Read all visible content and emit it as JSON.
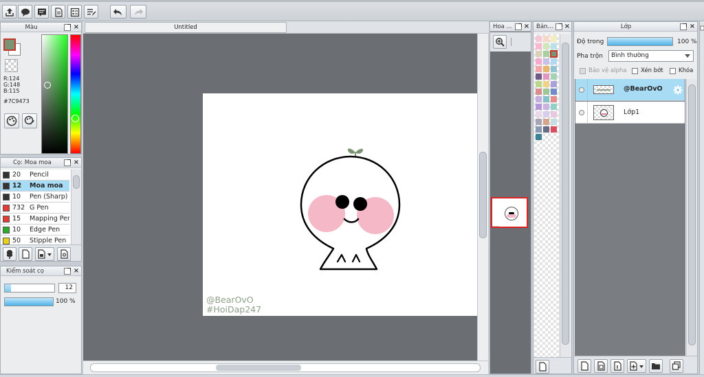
{
  "toolbar": {
    "buttons": [
      "export-icon",
      "comment-icon",
      "message-icon",
      "page-icon",
      "page-settings-icon",
      "list-edit-icon"
    ],
    "undo": "undo-icon",
    "redo": "redo-icon"
  },
  "color_panel": {
    "title": "Màu",
    "r": "R:124",
    "g": "G:148",
    "b": "B:115",
    "hex": "#7C9473",
    "main_color": "#7c9473",
    "sub_color": "#ffffff"
  },
  "canvas_tab": {
    "title": "Untitled"
  },
  "brush_panel": {
    "title": "Cọ: Moa moa",
    "brushes": [
      {
        "size": "20",
        "name": "Pencil",
        "color": "#333333"
      },
      {
        "size": "12",
        "name": "Moa moa",
        "color": "#333333",
        "selected": true
      },
      {
        "size": "10",
        "name": "Pen (Sharp)",
        "color": "#333333"
      },
      {
        "size": "732",
        "name": "G Pen",
        "color": "#e53935"
      },
      {
        "size": "15",
        "name": "Mapping Pen",
        "color": "#e53935"
      },
      {
        "size": "10",
        "name": "Edge Pen",
        "color": "#2eaa2e"
      },
      {
        "size": "50",
        "name": "Stipple Pen",
        "color": "#e8d21a"
      }
    ]
  },
  "brush_control": {
    "title": "Kiểm soát cọ",
    "size_value": "12",
    "size_fraction": 0.13,
    "opacity_label": "100 %",
    "opacity_fraction": 1.0
  },
  "navigator": {
    "title": "Hoa ..."
  },
  "swatch_panel": {
    "title": "Bản...",
    "colors": [
      "#f6c7d8",
      "#f7d7c8",
      "#f3eec2",
      "#f9b8cf",
      "#cfe8b9",
      "#b9e1ea",
      "#d9d2b8",
      "#a9cfa0",
      "#7c9473",
      "#f5aacd",
      "#c5c1e8",
      "#b5d8f2",
      "#f3a6a8",
      "#e7b56c",
      "#8fc4d7",
      "#6e5a86",
      "#e296c0",
      "#a3d3b5",
      "#b9d88d",
      "#f1d387",
      "#a7a2dc",
      "#d98d8c",
      "#9ec697",
      "#6f8bc8",
      "#c3b0de",
      "#86c0c9",
      "#e58d8d",
      "#b496d9",
      "#cab3de",
      "#8fd0c7",
      "#ecd8ec",
      "#d6cdea",
      "#e8c8e0",
      "#a7a4b6",
      "#d8a38d",
      "#c4dde2",
      "#8b9ab3",
      "#6a6c86",
      "#d94d5e",
      "#3c8194"
    ]
  },
  "layer_panel": {
    "title": "Lớp",
    "opacity_label": "Độ trong",
    "opacity_value": "100 %",
    "opacity_fraction": 1.0,
    "blend_label": "Pha trộn",
    "blend_value": "Bình thường",
    "protect_alpha": "Bảo vệ alpha",
    "clipping": "Xén bớt",
    "lock": "Khóa",
    "layers": [
      {
        "name": "@BearOvO",
        "selected": true
      },
      {
        "name": "Lớp1",
        "selected": false
      }
    ]
  },
  "artwork": {
    "watermark_line1": "@BearOvO",
    "watermark_line2": "#HoiDap247",
    "watermark_color": "#8fa08a",
    "blush_color": "#f5b8c6",
    "sprout_color": "#7c9473"
  },
  "colors": {
    "accent": "#7ec8ef",
    "workspace_bg": "#6b6e72",
    "selection": "#a8dcf5"
  }
}
